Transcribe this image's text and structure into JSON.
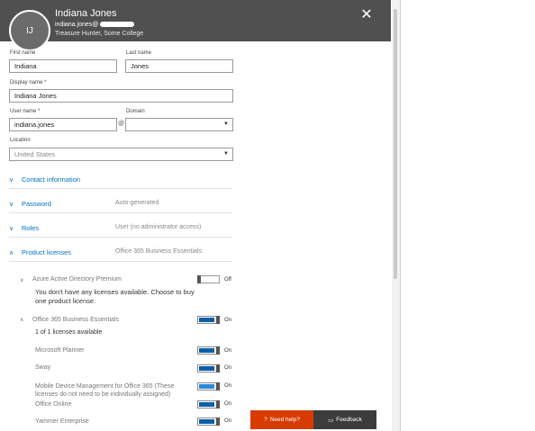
{
  "header": {
    "initials": "IJ",
    "name": "Indiana Jones",
    "email": "indiana.jones@",
    "subtitle": "Treasure Hunter, Some College",
    "close_glyph": "✕"
  },
  "form": {
    "first_name_label": "First name",
    "first_name": "Indiana",
    "last_name_label": "Last name",
    "last_name": "Jones",
    "display_name_label": "Display name *",
    "display_name": "Indiana Jones",
    "user_name_label": "User name *",
    "user_name": "indiana.jones",
    "at_sign": "@",
    "domain_label": "Domain",
    "domain_value": "",
    "location_label": "Location",
    "location_value": "United States"
  },
  "sections": [
    {
      "title": "Contact information",
      "value": "",
      "chevron": "∨"
    },
    {
      "title": "Password",
      "value": "Auto-generated",
      "chevron": "∨"
    },
    {
      "title": "Roles",
      "value": "User (no administrator access)",
      "chevron": "∨"
    },
    {
      "title": "Product licenses",
      "value": "Office 365 Business Essentials",
      "chevron": "∧"
    }
  ],
  "licenses": {
    "azure": {
      "name": "Azure Active Directory Premium",
      "state": "Off",
      "message": "You don't have any licenses available. Choose to buy one product license."
    },
    "o365": {
      "name": "Office 365 Business Essentials",
      "state": "On",
      "available": "1 of 1 licenses available"
    },
    "items": [
      {
        "name": "Microsoft Planner",
        "state": "On"
      },
      {
        "name": "Sway",
        "state": "On"
      },
      {
        "name": "Mobile Device Management for Office 365 (These licenses do not need to be individually assigned)",
        "state": "On"
      },
      {
        "name": "Office Online",
        "state": "On"
      },
      {
        "name": "Yammer Enterprise",
        "state": "On"
      }
    ]
  },
  "footer": {
    "help_label": "Need help?",
    "feedback_label": "Feedback"
  },
  "colors": {
    "accent": "#0072c6",
    "header": "#505050",
    "help": "#d83b01",
    "feedback": "#3c3c3c",
    "toggle_on": "#0b5ea8"
  }
}
